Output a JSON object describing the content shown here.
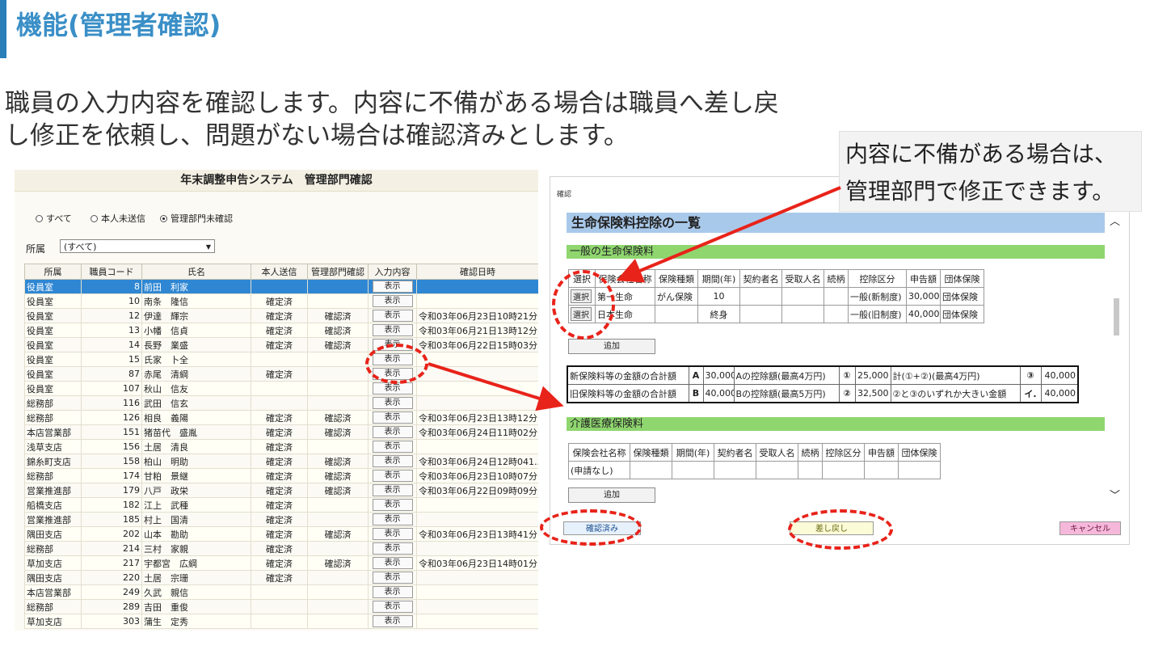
{
  "slide": {
    "title": "機能(管理者確認)",
    "description": [
      "職員の入力内容を確認します。内容に不備がある場合は職員へ差し戻",
      "し修正を依頼し、問題がない場合は確認済みとします。"
    ],
    "callout": [
      "内容に不備がある場合は、",
      "管理部門で修正できます。"
    ]
  },
  "left_window": {
    "title": "年末調整申告システム　管理部門確認",
    "filters": [
      {
        "label": "すべて",
        "checked": false
      },
      {
        "label": "本人未送信",
        "checked": false
      },
      {
        "label": "管理部門未確認",
        "checked": true
      }
    ],
    "dept_label": "所属",
    "dept_value": "(すべて)",
    "columns": [
      "所属",
      "職員コード",
      "氏名",
      "本人送信",
      "管理部門確認",
      "入力内容",
      "確認日時"
    ],
    "show_label": "表示",
    "rows": [
      {
        "dept": "役員室",
        "code": "8",
        "name": "前田　利家",
        "sent": "",
        "confirmed": "",
        "date": ""
      },
      {
        "dept": "役員室",
        "code": "10",
        "name": "南条　隆信",
        "sent": "確定済",
        "confirmed": "",
        "date": ""
      },
      {
        "dept": "役員室",
        "code": "12",
        "name": "伊達　輝宗",
        "sent": "確定済",
        "confirmed": "確認済",
        "date": "令和03年06月23日10時21分"
      },
      {
        "dept": "役員室",
        "code": "13",
        "name": "小幡　信貞",
        "sent": "確定済",
        "confirmed": "確認済",
        "date": "令和03年06月21日13時12分"
      },
      {
        "dept": "役員室",
        "code": "14",
        "name": "長野　業盛",
        "sent": "確定済",
        "confirmed": "確認済",
        "date": "令和03年06月22日15時03分"
      },
      {
        "dept": "役員室",
        "code": "15",
        "name": "氏家　卜全",
        "sent": "",
        "confirmed": "",
        "date": ""
      },
      {
        "dept": "役員室",
        "code": "87",
        "name": "赤尾　清綱",
        "sent": "確定済",
        "confirmed": "",
        "date": ""
      },
      {
        "dept": "役員室",
        "code": "107",
        "name": "秋山　信友",
        "sent": "",
        "confirmed": "",
        "date": ""
      },
      {
        "dept": "総務部",
        "code": "116",
        "name": "武田　信玄",
        "sent": "",
        "confirmed": "",
        "date": ""
      },
      {
        "dept": "総務部",
        "code": "126",
        "name": "相良　義陽",
        "sent": "確定済",
        "confirmed": "確認済",
        "date": "令和03年06月23日13時12分"
      },
      {
        "dept": "本店営業部",
        "code": "151",
        "name": "猪苗代　盛胤",
        "sent": "確定済",
        "confirmed": "確認済",
        "date": "令和03年06月24日11時02分"
      },
      {
        "dept": "浅草支店",
        "code": "156",
        "name": "土居　清良",
        "sent": "確定済",
        "confirmed": "",
        "date": ""
      },
      {
        "dept": "錦糸町支店",
        "code": "158",
        "name": "柏山　明助",
        "sent": "確定済",
        "confirmed": "確認済",
        "date": "令和03年06月24日12時041..."
      },
      {
        "dept": "総務部",
        "code": "174",
        "name": "甘粕　景継",
        "sent": "確定済",
        "confirmed": "確認済",
        "date": "令和03年06月23日10時07分"
      },
      {
        "dept": "営業推進部",
        "code": "179",
        "name": "八戸　政栄",
        "sent": "確定済",
        "confirmed": "確認済",
        "date": "令和03年06月22日09時09分"
      },
      {
        "dept": "船橋支店",
        "code": "182",
        "name": "江上　武種",
        "sent": "確定済",
        "confirmed": "",
        "date": ""
      },
      {
        "dept": "営業推進部",
        "code": "185",
        "name": "村上　国清",
        "sent": "確定済",
        "confirmed": "",
        "date": ""
      },
      {
        "dept": "隅田支店",
        "code": "202",
        "name": "山本　勘助",
        "sent": "確定済",
        "confirmed": "確認済",
        "date": "令和03年06月23日13時41分"
      },
      {
        "dept": "総務部",
        "code": "214",
        "name": "三村　家親",
        "sent": "確定済",
        "confirmed": "",
        "date": ""
      },
      {
        "dept": "草加支店",
        "code": "217",
        "name": "宇都宮　広綱",
        "sent": "確定済",
        "confirmed": "確認済",
        "date": "令和03年06月23日14時01分"
      },
      {
        "dept": "隅田支店",
        "code": "220",
        "name": "土居　宗珊",
        "sent": "確定済",
        "confirmed": "",
        "date": ""
      },
      {
        "dept": "本店営業部",
        "code": "249",
        "name": "久武　親信",
        "sent": "",
        "confirmed": "",
        "date": ""
      },
      {
        "dept": "総務部",
        "code": "289",
        "name": "吉田　重俊",
        "sent": "",
        "confirmed": "",
        "date": ""
      },
      {
        "dept": "草加支店",
        "code": "303",
        "name": "蒲生　定秀",
        "sent": "",
        "confirmed": "",
        "date": ""
      }
    ]
  },
  "right_window": {
    "title": "確認",
    "section_title": "生命保険料控除の一覧",
    "general": {
      "title": "一般の生命保険料",
      "columns": [
        "選択",
        "保険会社名称",
        "保険種類",
        "期間(年)",
        "契約者名",
        "受取人名",
        "続柄",
        "控除区分",
        "申告額",
        "団体保険"
      ],
      "select_label": "選択",
      "rows": [
        {
          "company": "第一生命",
          "type": "がん保険",
          "period": "10",
          "holder": "",
          "recipient": "",
          "relation": "",
          "category": "一般(新制度)",
          "amount": "30,000",
          "group": "団体保険"
        },
        {
          "company": "日本生命",
          "type": "",
          "period": "終身",
          "holder": "",
          "recipient": "",
          "relation": "",
          "category": "一般(旧制度)",
          "amount": "40,000",
          "group": "団体保険"
        }
      ],
      "add_label": "追加"
    },
    "summary": [
      {
        "label": "新保険料等の金額の合計額",
        "key": "A",
        "value": "30,000",
        "deduct_label": "Aの控除額(最高4万円)",
        "mark": "①",
        "deduct": "25,000",
        "calc_label": "計(①+②)(最高4万円)",
        "result_mark": "③",
        "result": "40,000"
      },
      {
        "label": "旧保険料等の金額の合計額",
        "key": "B",
        "value": "40,000",
        "deduct_label": "Bの控除額(最高5万円)",
        "mark": "②",
        "deduct": "32,500",
        "calc_label": "②と③のいずれか大きい金額",
        "result_mark": "イ.",
        "result": "40,000"
      }
    ],
    "care": {
      "title": "介護医療保険料",
      "columns": [
        "保険会社名称",
        "保険種類",
        "期間(年)",
        "契約者名",
        "受取人名",
        "続柄",
        "控除区分",
        "申告額",
        "団体保険"
      ],
      "empty_label": "(申請なし)",
      "add_label": "追加"
    },
    "buttons": {
      "confirm": "確認済み",
      "return": "差し戻し",
      "cancel": "キャンセル"
    }
  },
  "colors": {
    "accent": "#3a8fc7",
    "banner": "#a9c9ea",
    "section_bar": "#8fd66f",
    "annotation": "#e8231a",
    "selected_row": "#2f87d3"
  }
}
